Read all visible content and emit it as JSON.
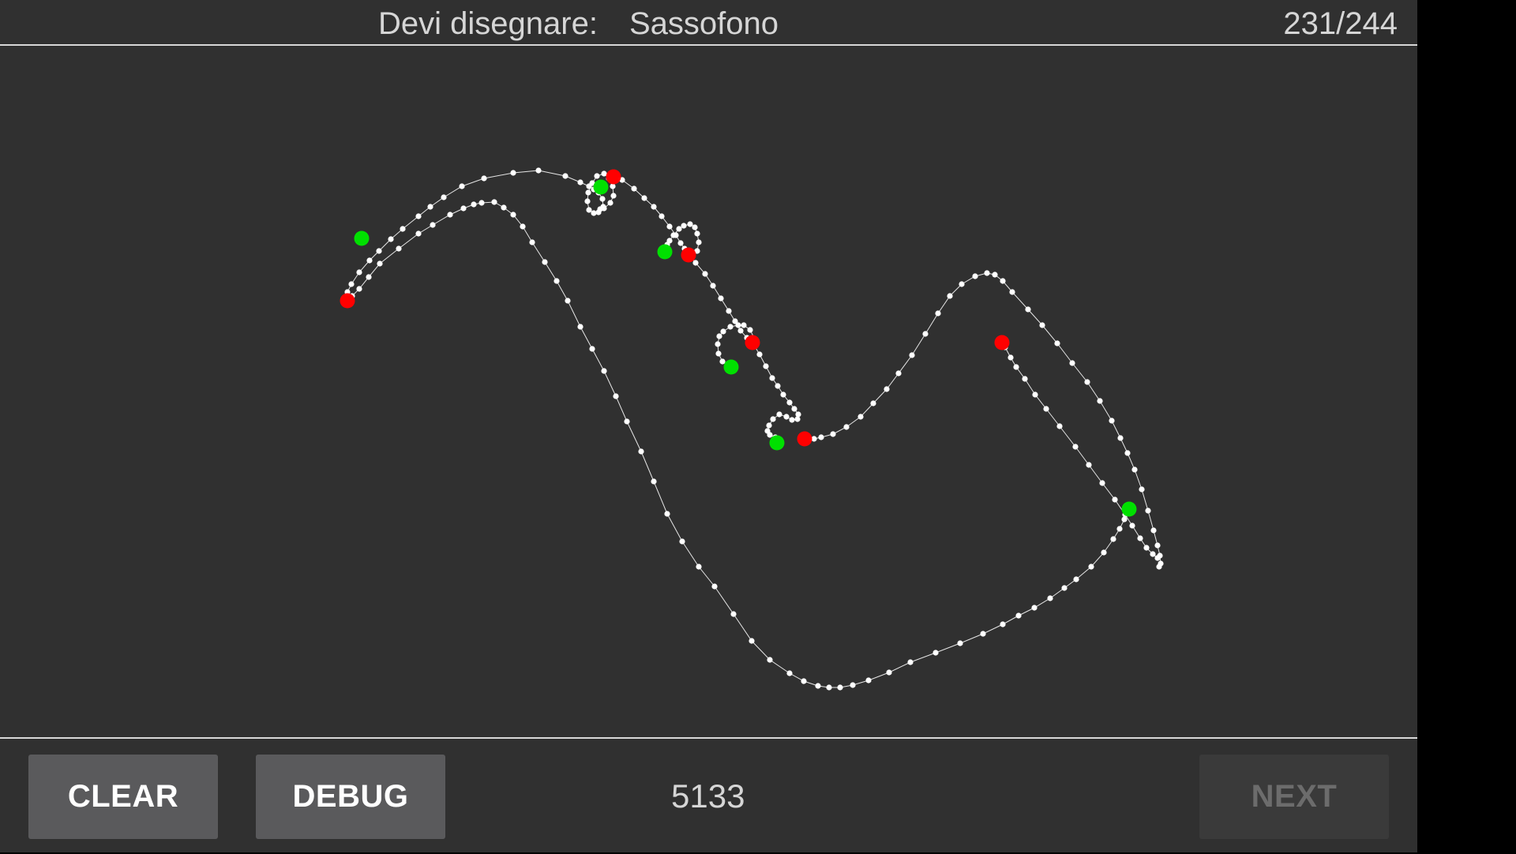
{
  "header": {
    "prompt_label": "Devi disegnare:",
    "prompt_word": "Sassofono",
    "counter": "231/244"
  },
  "footer": {
    "clear_label": "CLEAR",
    "debug_label": "DEBUG",
    "score": "5133",
    "next_label": "NEXT"
  },
  "colors": {
    "background": "#303030",
    "stroke_point": "#ffffff",
    "start_marker": "#00e000",
    "end_marker": "#ff0000"
  }
}
